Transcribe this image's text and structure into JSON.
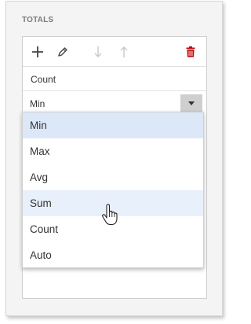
{
  "section": {
    "title": "TOTALS"
  },
  "toolbar": {
    "buttons": [
      {
        "icon": "plus-icon",
        "enabled": true
      },
      {
        "icon": "pencil-icon",
        "enabled": true
      },
      {
        "icon": "arrow-down-icon",
        "enabled": false
      },
      {
        "icon": "arrow-up-icon",
        "enabled": false
      },
      {
        "icon": "trash-icon",
        "enabled": true
      }
    ]
  },
  "total": {
    "label": "Count",
    "select_value": "Min"
  },
  "dropdown": {
    "options": [
      "Min",
      "Max",
      "Avg",
      "Sum",
      "Count",
      "Auto"
    ],
    "selected_index": 0,
    "hover_index": 3
  },
  "colors": {
    "accent_delete": "#c00000",
    "disabled": "#c8c8c8",
    "selected_bg": "#dce8f8",
    "hover_bg": "#e8f0fb"
  }
}
